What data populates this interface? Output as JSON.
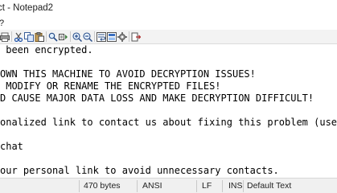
{
  "window": {
    "title": "ct - Notepad2"
  },
  "menu": {
    "items": [
      "?"
    ]
  },
  "toolbar": {
    "buttons": [
      "print-icon",
      "cut-icon",
      "copy-icon",
      "paste-icon",
      "find-icon",
      "replace-icon",
      "zoom-in-icon",
      "zoom-out-icon",
      "word-wrap-icon",
      "view-icon",
      "settings-icon",
      "exit-icon"
    ]
  },
  "editor": {
    "lines": [
      " been encrypted.",
      "",
      "OWN THIS MACHINE TO AVOID DECRYPTION ISSUES!",
      " MODIFY OR RENAME THE ENCRYPTED FILES!",
      "D CAUSE MAJOR DATA LOSS AND MAKE DECRYPTION DIFFICULT!",
      "",
      "onalized link to contact us about fixing this problem (use the",
      "",
      "chat",
      "",
      "our personal link to avoid unnecessary contacts."
    ]
  },
  "statusbar": {
    "size": "470 bytes",
    "encoding": "ANSI",
    "eol": "LF",
    "ins": "INS",
    "scheme": "Default Text"
  }
}
